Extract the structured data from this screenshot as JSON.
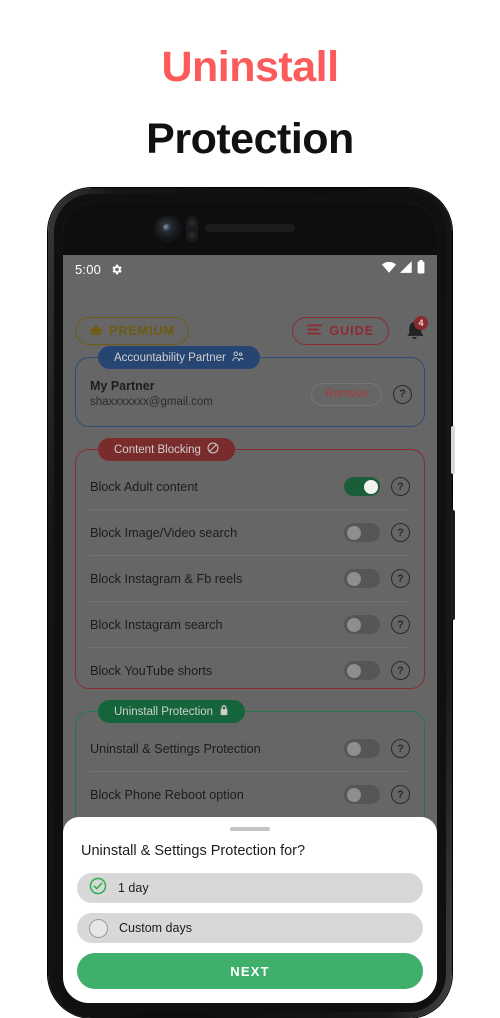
{
  "headline": {
    "line1": "Uninstall",
    "line2": "Protection",
    "line1_color": "#fb5b5b",
    "line2_color": "#111111"
  },
  "status_bar": {
    "time": "5:00",
    "gear_icon": "gear-icon",
    "wifi_icon": "wifi-icon",
    "signal_icon": "cellular-signal-icon",
    "battery_icon": "battery-icon"
  },
  "top_bar": {
    "premium_label": "PREMIUM",
    "premium_icon": "crown-icon",
    "premium_color": "#6f5b12",
    "guide_label": "GUIDE",
    "guide_icon": "hamburger-lines-icon",
    "guide_color": "#8d2a31",
    "bell_icon": "bell-icon",
    "bell_badge_count": "4",
    "bell_badge_color": "#8d2a31"
  },
  "sections": [
    {
      "id": "accountability-partner",
      "label": "Accountability Partner",
      "label_icon": "people-icon",
      "label_bg": "#264573",
      "border_color": "#2e4b78",
      "partner": {
        "name": "My Partner",
        "email": "shaxxxxxxx@gmail.com",
        "remove_label": "Remove",
        "remove_color": "#a83a3a",
        "help_icon": "question-mark-icon"
      }
    },
    {
      "id": "content-blocking",
      "label": "Content Blocking",
      "label_icon": "prohibition-icon",
      "label_bg": "#7a2b2b",
      "border_color": "#8d2a31",
      "rows": [
        {
          "label": "Block Adult content",
          "state": "on",
          "help_icon": "question-mark-icon"
        },
        {
          "label": "Block Image/Video search",
          "state": "off",
          "help_icon": "question-mark-icon"
        },
        {
          "label": "Block Instagram & Fb reels",
          "state": "off",
          "help_icon": "question-mark-icon"
        },
        {
          "label": "Block Instagram search",
          "state": "off",
          "help_icon": "question-mark-icon"
        },
        {
          "label": "Block YouTube shorts",
          "state": "off",
          "help_icon": "question-mark-icon"
        }
      ]
    },
    {
      "id": "uninstall-protection",
      "label": "Uninstall Protection",
      "label_icon": "lock-icon",
      "label_bg": "#14653c",
      "border_color": "#1f7a4d",
      "rows": [
        {
          "label": "Uninstall & Settings Protection",
          "state": "off",
          "help_icon": "question-mark-icon"
        },
        {
          "label": "Block Phone Reboot option",
          "state": "off",
          "help_icon": "question-mark-icon"
        }
      ]
    }
  ],
  "bottom_sheet": {
    "title": "Uninstall & Settings Protection for?",
    "options": [
      {
        "label": "1 day",
        "selected": true,
        "icon": "check-circle-icon"
      },
      {
        "label": "Custom days",
        "selected": false,
        "icon": "radio-empty-icon"
      }
    ],
    "next_label": "NEXT",
    "next_color": "#3fb06c",
    "check_color": "#2eb34e"
  }
}
